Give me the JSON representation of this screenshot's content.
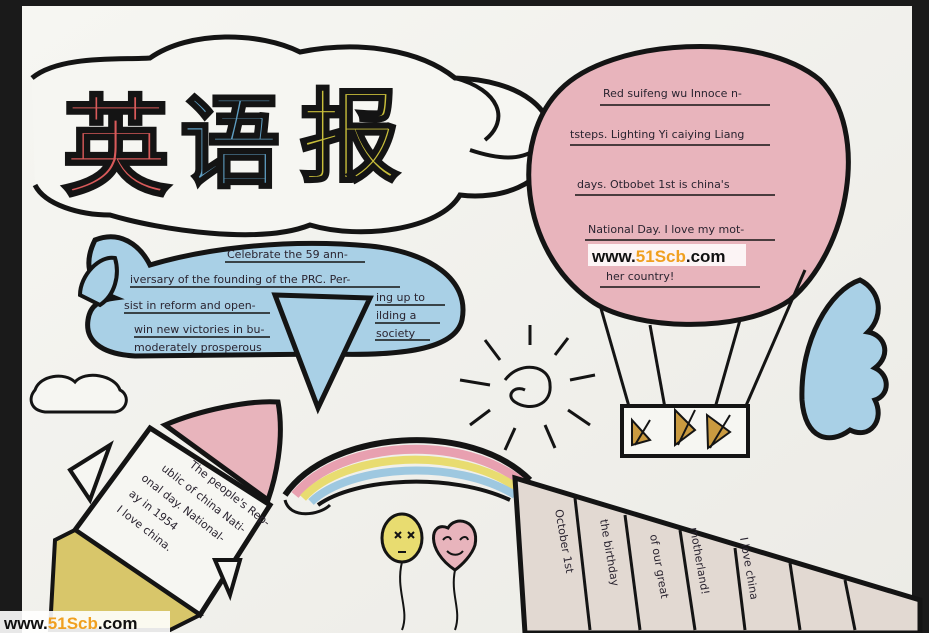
{
  "title": {
    "chars": [
      "英",
      "语",
      "报"
    ],
    "colors": [
      "#d95a5a",
      "#5f9fc4",
      "#c8be3a"
    ]
  },
  "balloon": {
    "lines": [
      "Red suifeng wu Innoce n-",
      "tsteps. Lighting Yi caiying Liang",
      "days. Otbobet 1st is china's",
      "National Day. I love my mot-",
      "her country!"
    ],
    "fill": "#e8b4bc"
  },
  "airplane": {
    "lines": [
      "Celebrate the 59 ann-",
      "iversary of the founding of the PRC. Per-",
      "sist in reform and open-",
      "win new victories in bu-",
      "moderately prosperous"
    ],
    "right_lines": [
      "ing up to",
      "ilding a",
      "society"
    ],
    "fill": "#a9d0e6"
  },
  "rocket": {
    "lines": [
      "The people's Rep-",
      "ublic of china Nati-",
      "onal day. National-",
      "ay in 1954",
      "I love china."
    ]
  },
  "tent": {
    "lines": [
      "October 1st",
      "the birthday",
      "of our great",
      "motherland!",
      "I love china"
    ]
  },
  "watermark": {
    "prefix": "www.",
    "brand_a": "51",
    "brand_b": "Scb",
    "suffix": ".com",
    "accent": "#f0a020"
  }
}
